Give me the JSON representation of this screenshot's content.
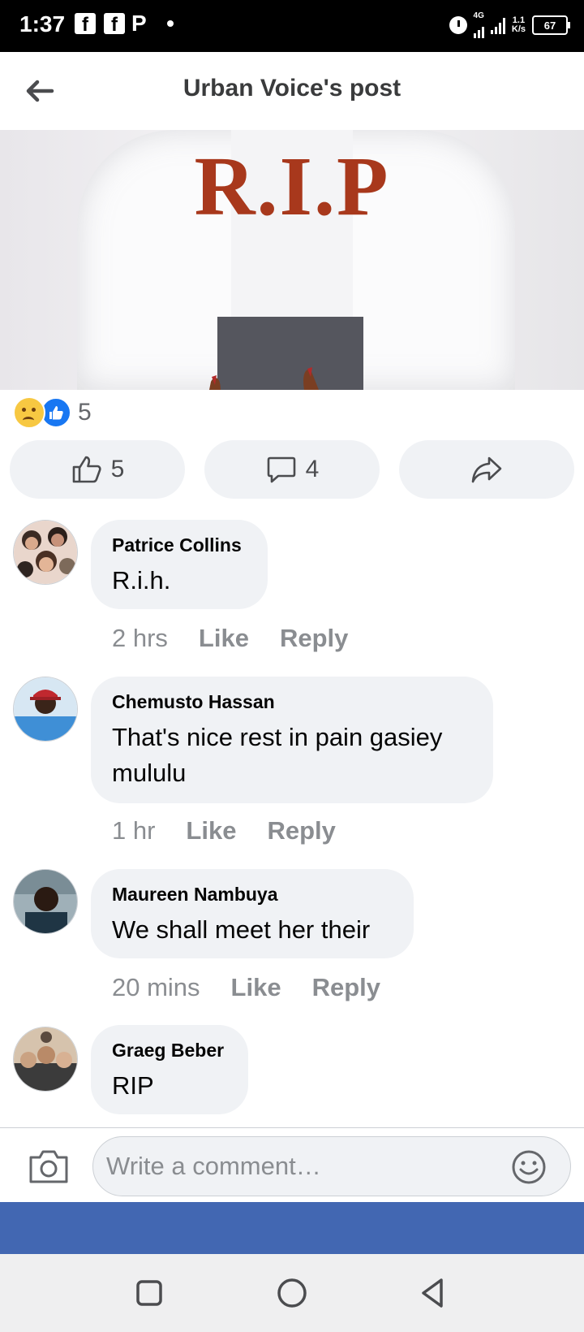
{
  "status_bar": {
    "time": "1:37",
    "notif_icons": [
      "facebook-icon",
      "facebook-icon",
      "pinterest-icon",
      "dot-icon"
    ],
    "network": "4G",
    "speed_value": "1.1",
    "speed_unit": "K/s",
    "battery": "67"
  },
  "header": {
    "title": "Urban Voice's post",
    "back_icon": "back-arrow-icon"
  },
  "post": {
    "image_text": "R.I.P",
    "reaction_count": "5",
    "reactions": [
      "sad-reaction-icon",
      "like-reaction-icon"
    ]
  },
  "actions": {
    "like_count": "5",
    "comment_count": "4",
    "share_icon": "share-icon"
  },
  "comments": [
    {
      "name": "Patrice Collins",
      "text": "R.i.h.",
      "time": "2 hrs",
      "like": "Like",
      "reply": "Reply"
    },
    {
      "name": "Chemusto Hassan",
      "text": "That's nice rest in pain gasiey mululu",
      "time": "1 hr",
      "like": "Like",
      "reply": "Reply"
    },
    {
      "name": "Maureen Nambuya",
      "text": "We shall meet her their",
      "time": "20 mins",
      "like": "Like",
      "reply": "Reply"
    },
    {
      "name": "Graeg Beber",
      "text": "RIP"
    }
  ],
  "composer": {
    "placeholder": "Write a comment…"
  },
  "colors": {
    "brand_blue": "#4267b2",
    "like_blue": "#1877f2",
    "rip_red": "#a8381c",
    "bubble_gray": "#f0f2f5"
  }
}
